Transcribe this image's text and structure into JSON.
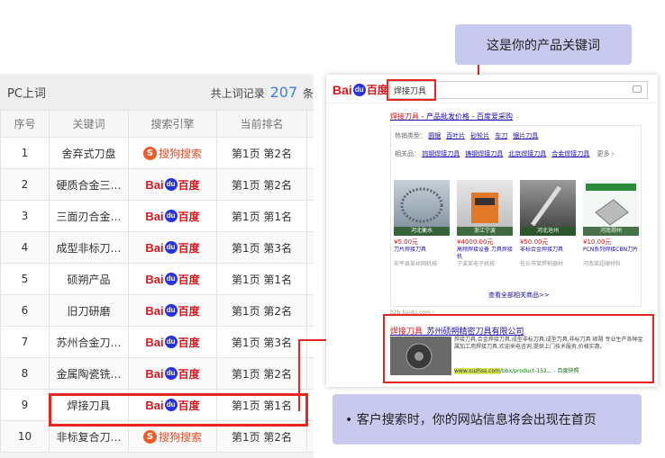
{
  "rank_table": {
    "title": "PC上词",
    "total_prefix": "共上词记录",
    "total_count": "207",
    "total_suffix": "条",
    "columns": [
      "序号",
      "关键词",
      "搜索引擎",
      "当前排名"
    ],
    "rows": [
      {
        "no": "1",
        "keyword": "舍弃式刀盘",
        "engine": "sogou",
        "rank": "第1页 第2名"
      },
      {
        "no": "2",
        "keyword": "硬质合金三…",
        "engine": "baidu",
        "rank": "第1页 第2名"
      },
      {
        "no": "3",
        "keyword": "三面刃合金…",
        "engine": "baidu",
        "rank": "第1页 第1名"
      },
      {
        "no": "4",
        "keyword": "成型非标刀…",
        "engine": "baidu",
        "rank": "第1页 第3名"
      },
      {
        "no": "5",
        "keyword": "硕朔产品",
        "engine": "baidu",
        "rank": "第1页 第1名"
      },
      {
        "no": "6",
        "keyword": "旧刀研磨",
        "engine": "baidu",
        "rank": "第1页 第2名"
      },
      {
        "no": "7",
        "keyword": "苏州合金刀…",
        "engine": "baidu",
        "rank": "第1页 第3名"
      },
      {
        "no": "8",
        "keyword": "金属陶瓷铣…",
        "engine": "baidu",
        "rank": "第1页 第2名"
      },
      {
        "no": "9",
        "keyword": "焊接刀具",
        "engine": "baidu",
        "rank": "第1页 第1名"
      },
      {
        "no": "10",
        "keyword": "非标复合刀…",
        "engine": "sogou",
        "rank": "第1页 第2名"
      }
    ],
    "engines": {
      "baidu": {
        "latin": "Bai",
        "paw": "du",
        "cn": "百度"
      },
      "sogou": {
        "badge": "S",
        "text": "搜狗搜索"
      }
    }
  },
  "callouts": {
    "keyword_note": "这是你的产品关键词",
    "result_note": "• 客户搜索时，你的网站信息将会出现在首页"
  },
  "serp": {
    "logo_latin": "Bai",
    "logo_paw": "du",
    "logo_cn": "百度",
    "query": "焊接刀具",
    "ad_title_red": "焊接刀具",
    "ad_title_rest": " - 产品批发价格 - 百度爱采购",
    "cat_row1_label": "热销类型：",
    "cat_row1": [
      "圆锯",
      "百叶片",
      "砂轮片",
      "车刀",
      "锯片刀具"
    ],
    "cat_row2_label": "相关品：",
    "cat_row2": [
      "钨钢焊接刀具",
      "铸钢焊接刀具",
      "北京焊接刀具",
      "合金焊接刀具"
    ],
    "cat_more": "更多 ›",
    "products": [
      {
        "caption": "河北衡水",
        "price": "¥5.00元",
        "name": "刀片焊接刀具",
        "desc": "安平县某丝网机械"
      },
      {
        "caption": "浙江宁波",
        "price": "¥4000.00元",
        "name": "高频焊接设备 刀具焊接机",
        "desc": "宁波某电子机械"
      },
      {
        "caption": "河北沧州",
        "price": "¥50.00元",
        "name": "非标合金焊接刀具",
        "desc": "任丘市某焊割器材"
      },
      {
        "caption": "河南郑州",
        "price": "¥10.00元",
        "name": "PCN系列焊接CBN刀片",
        "desc": "河南某超硬材料"
      }
    ],
    "more_link": "查看全部相关商品>>",
    "b2b": "b2b.baidu.com ›",
    "org_title_red": "焊接刀具",
    "org_title_rest": "_苏州硕朔精密刀具有限公司",
    "org_text": "焊接刀具,合金焊接刀具,成型非标刀具,成型刀具,非标刀具 硕朔 专业生产各种金属加工用焊接刀具,欢迎来电咨询,提供上门技术服务,价格实惠。",
    "org_url_hl": "www.suzhss.com",
    "org_url_rest": "/bbx/product-152...  - 百度快照"
  }
}
